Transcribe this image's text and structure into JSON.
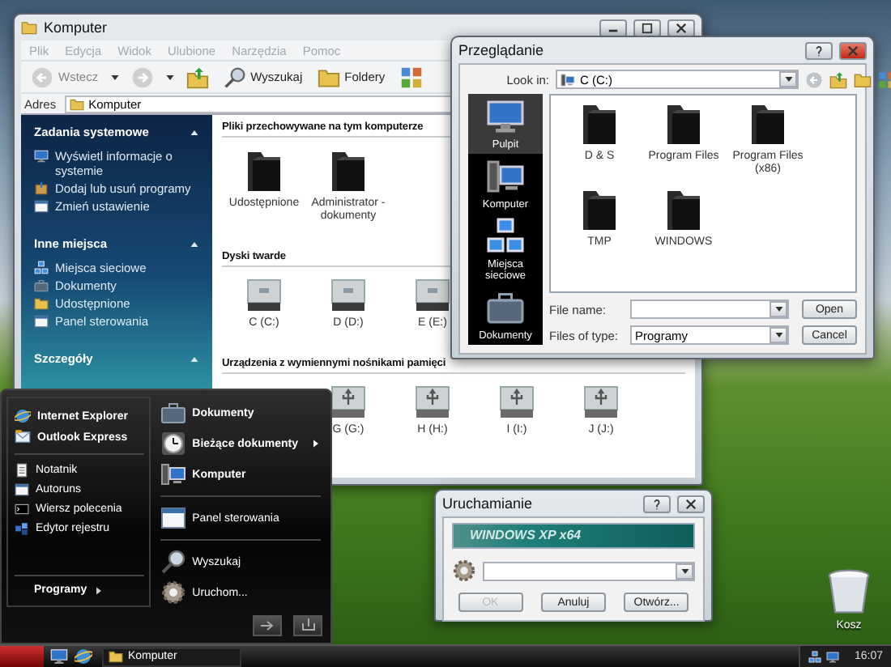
{
  "explorer": {
    "title": "Komputer",
    "menu": [
      "Plik",
      "Edycja",
      "Widok",
      "Ulubione",
      "Narzędzia",
      "Pomoc"
    ],
    "toolbar": [
      {
        "kind": "back",
        "label": "Wstecz",
        "disabled": true
      },
      {
        "kind": "forward",
        "disabled": true
      },
      {
        "kind": "up",
        "disabled": false
      },
      {
        "kind": "search",
        "label": "Wyszukaj",
        "disabled": false
      },
      {
        "kind": "folders",
        "label": "Foldery",
        "disabled": false
      },
      {
        "kind": "views",
        "disabled": false
      }
    ],
    "address": {
      "label": "Adres",
      "value": "Komputer"
    },
    "panels": [
      {
        "title": "Zadania systemowe",
        "items": [
          {
            "kind": "info",
            "label": "Wyświetl informacje o systemie"
          },
          {
            "kind": "add",
            "label": "Dodaj lub usuń programy"
          },
          {
            "kind": "settings",
            "label": "Zmień ustawienie"
          }
        ]
      },
      {
        "title": "Inne miejsca",
        "items": [
          {
            "kind": "network",
            "label": "Miejsca sieciowe"
          },
          {
            "kind": "documents",
            "label": "Dokumenty"
          },
          {
            "kind": "shared",
            "label": "Udostępnione"
          },
          {
            "kind": "control",
            "label": "Panel sterowania"
          }
        ]
      },
      {
        "title": "Szczegóły"
      }
    ],
    "sections": [
      {
        "title": "Pliki przechowywane na tym komputerze",
        "kind": "folder",
        "items": [
          "Udostępnione",
          "Administrator - dokumenty"
        ]
      },
      {
        "title": "Dyski twarde",
        "kind": "disk",
        "items": [
          "C (C:)",
          "D (D:)",
          "E (E:)"
        ]
      },
      {
        "title": "Urządzenia z wymiennymi nośnikami pamięci",
        "kind": "usb",
        "items": [
          "G (G:)",
          "H (H:)",
          "I (I:)",
          "J (J:)"
        ]
      }
    ]
  },
  "browse": {
    "title": "Przeglądanie",
    "look_in_label": "Look in:",
    "look_in": "C (C:)",
    "places": [
      {
        "kind": "desktop",
        "label": "Pulpit",
        "selected": true
      },
      {
        "kind": "computer",
        "label": "Komputer",
        "selected": false
      },
      {
        "kind": "network",
        "label": "Miejsca sieciowe",
        "selected": false
      },
      {
        "kind": "documents",
        "label": "Dokumenty",
        "selected": false
      }
    ],
    "files": [
      "D & S",
      "Program Files",
      "Program Files (x86)",
      "TMP",
      "WINDOWS"
    ],
    "file_name_label": "File name:",
    "file_type_label": "Files of type:",
    "file_type": "Programy",
    "buttons": [
      "Open",
      "Cancel"
    ]
  },
  "start_menu": {
    "pinned": [
      {
        "kind": "browser",
        "label": "Internet Explorer"
      },
      {
        "kind": "mail",
        "label": "Outlook Express"
      }
    ],
    "recent": [
      {
        "kind": "notepad",
        "label": "Notatnik"
      },
      {
        "kind": "autoruns",
        "label": "Autoruns"
      },
      {
        "kind": "terminal",
        "label": "Wiersz polecenia"
      },
      {
        "kind": "registry",
        "label": "Edytor rejestru"
      }
    ],
    "all_programs": "Programy",
    "places": [
      {
        "kind": "documents",
        "label": "Dokumenty",
        "bold": true,
        "submenu": false
      },
      {
        "kind": "recent",
        "label": "Bieżące dokumenty",
        "bold": true,
        "submenu": true
      },
      {
        "kind": "computer",
        "label": "Komputer",
        "bold": true,
        "submenu": false
      },
      {
        "kind": "control",
        "label": "Panel sterowania",
        "bold": false,
        "submenu": false
      },
      {
        "kind": "search",
        "label": "Wyszukaj",
        "bold": false,
        "submenu": false
      },
      {
        "kind": "run",
        "label": "Uruchom...",
        "bold": false,
        "submenu": false
      }
    ]
  },
  "run": {
    "title": "Uruchamianie",
    "banner": "WINDOWS XP x64",
    "buttons": [
      {
        "label": "OK",
        "disabled": true
      },
      {
        "label": "Anuluj",
        "disabled": false
      },
      {
        "label": "Otwórz...",
        "disabled": false
      }
    ]
  },
  "desktop_icons": [
    {
      "kind": "recycle_bin",
      "label": "Kosz"
    }
  ],
  "taskbar": {
    "quick_launch": [
      {
        "kind": "desktop"
      },
      {
        "kind": "browser"
      }
    ],
    "tasks": [
      {
        "label": "Komputer"
      }
    ],
    "clock": "16:07"
  }
}
